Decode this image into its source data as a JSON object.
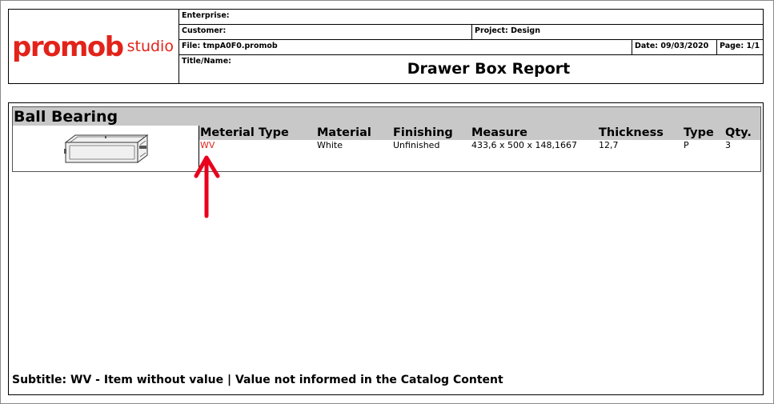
{
  "header": {
    "logo": {
      "main": "promob",
      "sub": "studio"
    },
    "enterprise_label": "Enterprise:",
    "customer_label": "Customer:",
    "project": "Project: Design",
    "file": "File: tmpA0F0.promob",
    "date": "Date: 09/03/2020",
    "page": "Page: 1/1",
    "title_label": "Title/Name:",
    "report_title": "Drawer Box Report"
  },
  "section": {
    "title": "Ball Bearing",
    "columns": [
      "Meterial Type",
      "Material",
      "Finishing",
      "Measure",
      "Thickness",
      "Type",
      "Qty."
    ],
    "row": [
      "WV",
      "White",
      "Unfinished",
      "433,6 x 500 x 148,1667",
      "12,7",
      "P",
      "3"
    ]
  },
  "footer": {
    "subtitle": "Subtitle: WV - Item without value | Value not informed in the Catalog Content"
  },
  "colors": {
    "brand": "#e2231a",
    "arrow": "#e8001c",
    "header_bg": "#c8c8c8"
  },
  "icons": {
    "drawer": "drawer-box-icon",
    "arrow": "up-arrow-icon"
  }
}
